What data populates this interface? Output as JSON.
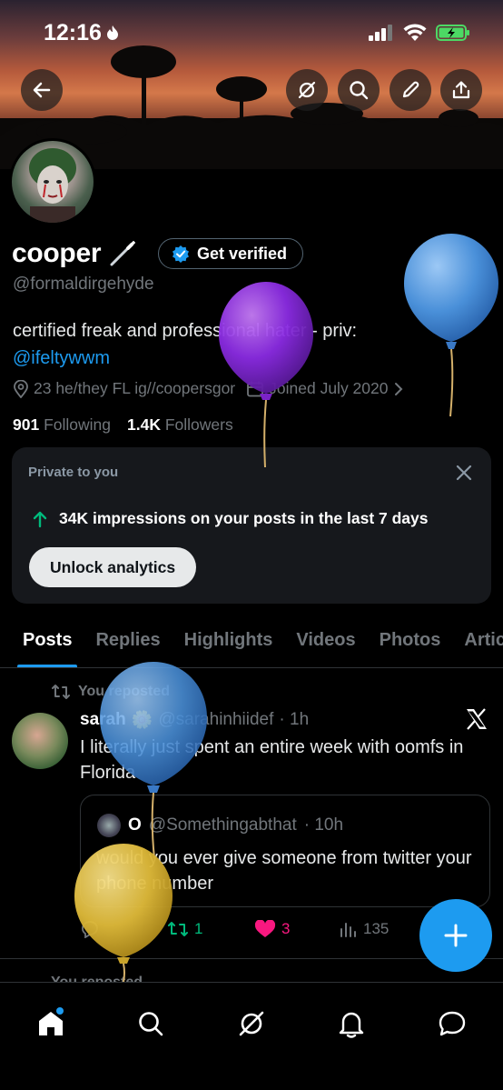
{
  "status_bar": {
    "time": "12:16"
  },
  "profile": {
    "display_name": "cooper",
    "verify_label": "Get verified",
    "handle": "@formaldirgehyde",
    "bio_text": "certified freak and professional hater - priv:",
    "bio_mention": "@ifeltywwm",
    "location_text": "23 he/they FL ig//coopersgor",
    "joined_text": "Joined July 2020",
    "following_count": "901",
    "following_label": "Following",
    "followers_count": "1.4K",
    "followers_label": "Followers"
  },
  "analytics": {
    "title": "Private to you",
    "impressions_text": "34K impressions on your posts in the last 7 days",
    "button_label": "Unlock analytics"
  },
  "tabs": [
    {
      "label": "Posts"
    },
    {
      "label": "Replies"
    },
    {
      "label": "Highlights"
    },
    {
      "label": "Videos"
    },
    {
      "label": "Photos"
    },
    {
      "label": "Articles"
    }
  ],
  "post": {
    "repost_label": "You reposted",
    "author_name": "sarah",
    "author_emoji": "🌼",
    "author_handle": "@sarahinhiidef",
    "time": "· 1h",
    "text": "I literally just spent an entire week with oomfs in Florida",
    "quote": {
      "author_name": "O",
      "author_handle": "@Somethingabthat",
      "time": "· 10h",
      "text": "would you ever give someone from twitter your phone number"
    },
    "reposts": "1",
    "likes": "3",
    "views": "135"
  },
  "next_post": {
    "repost_label": "You reposted"
  },
  "colors": {
    "accent": "#1d9bf0",
    "like": "#f91880",
    "repost": "#00ba7c",
    "background": "#000000"
  },
  "balloon_colors": [
    "#4a90d9",
    "#8a2be2",
    "#4a90d9",
    "#e0bb3a"
  ]
}
